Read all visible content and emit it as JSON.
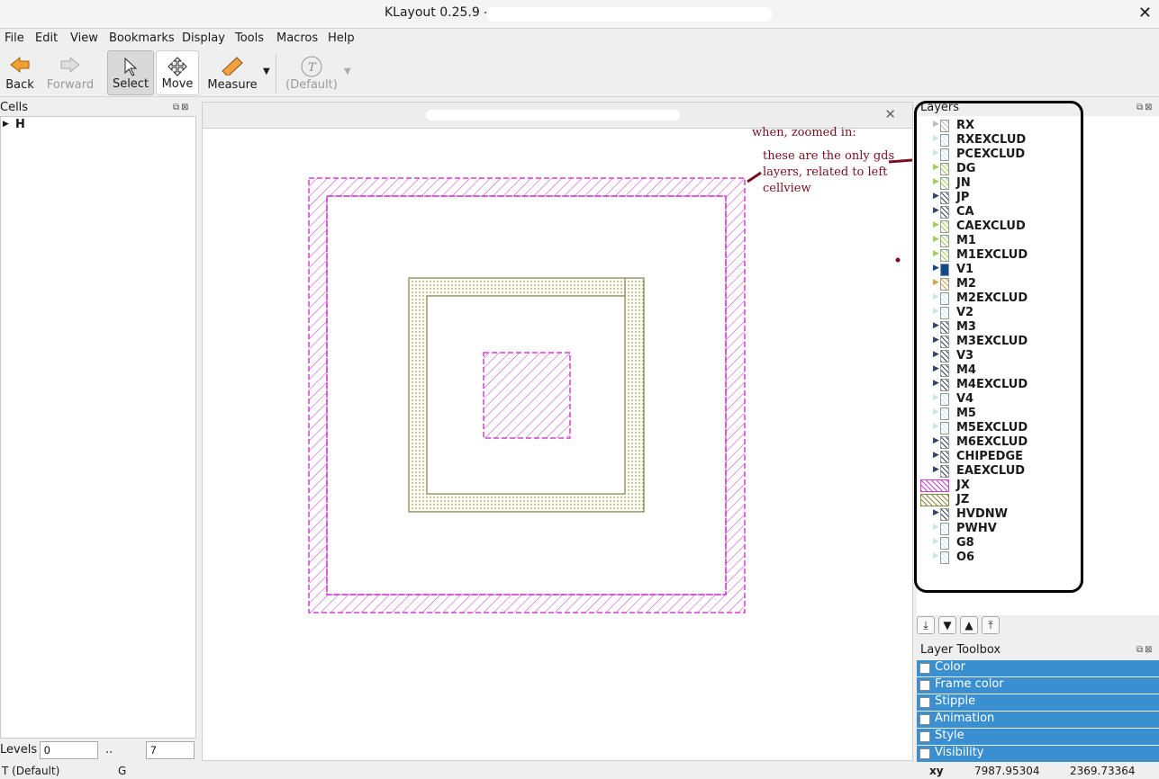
{
  "window": {
    "title": "KLayout 0.25.9 -",
    "close": "✕"
  },
  "menu": [
    "File",
    "Edit",
    "View",
    "Bookmarks",
    "Display",
    "Tools",
    "Macros",
    "Help"
  ],
  "toolbar": {
    "back": "Back",
    "forward": "Forward",
    "select": "Select",
    "move": "Move",
    "measure": "Measure",
    "text_default": "(Default)"
  },
  "cells": {
    "title": "Cells",
    "root": "H"
  },
  "canvas": {
    "close": "✕"
  },
  "layers_panel": {
    "title": "Layers",
    "layers": [
      {
        "name": "RX",
        "color": "#bbbbbb"
      },
      {
        "name": "RXEXCLUD",
        "color": "#bfe9f0"
      },
      {
        "name": "PCEXCLUD",
        "color": "#bfe9f0"
      },
      {
        "name": "DG",
        "color": "#9ad35a"
      },
      {
        "name": "JN",
        "color": "#9ad35a"
      },
      {
        "name": "JP",
        "color": "#334466"
      },
      {
        "name": "CA",
        "color": "#334466"
      },
      {
        "name": "CAEXCLUD",
        "color": "#9ad35a"
      },
      {
        "name": "M1",
        "color": "#9ad35a"
      },
      {
        "name": "M1EXCLUD",
        "color": "#9ad35a"
      },
      {
        "name": "V1",
        "color": "#0d4b8a"
      },
      {
        "name": "M2",
        "color": "#d7a24a"
      },
      {
        "name": "M2EXCLUD",
        "color": "#bfe9f0"
      },
      {
        "name": "V2",
        "color": "#bfe9f0"
      },
      {
        "name": "M3",
        "color": "#334466"
      },
      {
        "name": "M3EXCLUD",
        "color": "#334466"
      },
      {
        "name": "V3",
        "color": "#334466"
      },
      {
        "name": "M4",
        "color": "#334466"
      },
      {
        "name": "M4EXCLUD",
        "color": "#334466"
      },
      {
        "name": "V4",
        "color": "#bfe9f0"
      },
      {
        "name": "M5",
        "color": "#bfe9f0"
      },
      {
        "name": "M5EXCLUD",
        "color": "#bfe9f0"
      },
      {
        "name": "M6EXCLUD",
        "color": "#334466"
      },
      {
        "name": "CHIPEDGE",
        "color": "#334466"
      },
      {
        "name": "EAEXCLUD",
        "color": "#334466"
      },
      {
        "name": "JX",
        "color": "#d63fd6"
      },
      {
        "name": "JZ",
        "color": "#8a8a40"
      },
      {
        "name": "HVDNW",
        "color": "#334466"
      },
      {
        "name": "PWHV",
        "color": "#bfe9f0"
      },
      {
        "name": "G8",
        "color": "#bfe9f0"
      },
      {
        "name": "O6",
        "color": "#bfe9f0"
      }
    ]
  },
  "annotations": {
    "line1": "when, zoomed in:",
    "line2": "these are the only gds",
    "line3": "layers, related to left",
    "line4": "cellview"
  },
  "layer_toolbox": {
    "title": "Layer Toolbox",
    "items": [
      "Color",
      "Frame color",
      "Stipple",
      "Animation",
      "Style",
      "Visibility"
    ]
  },
  "levels": {
    "label": "Levels",
    "from": "0",
    "sep": "..",
    "to": "7"
  },
  "status": {
    "left1": "T  (Default)",
    "left2": "G",
    "xy_label": "xy",
    "x": "7987.95304",
    "y": "2369.73364"
  }
}
